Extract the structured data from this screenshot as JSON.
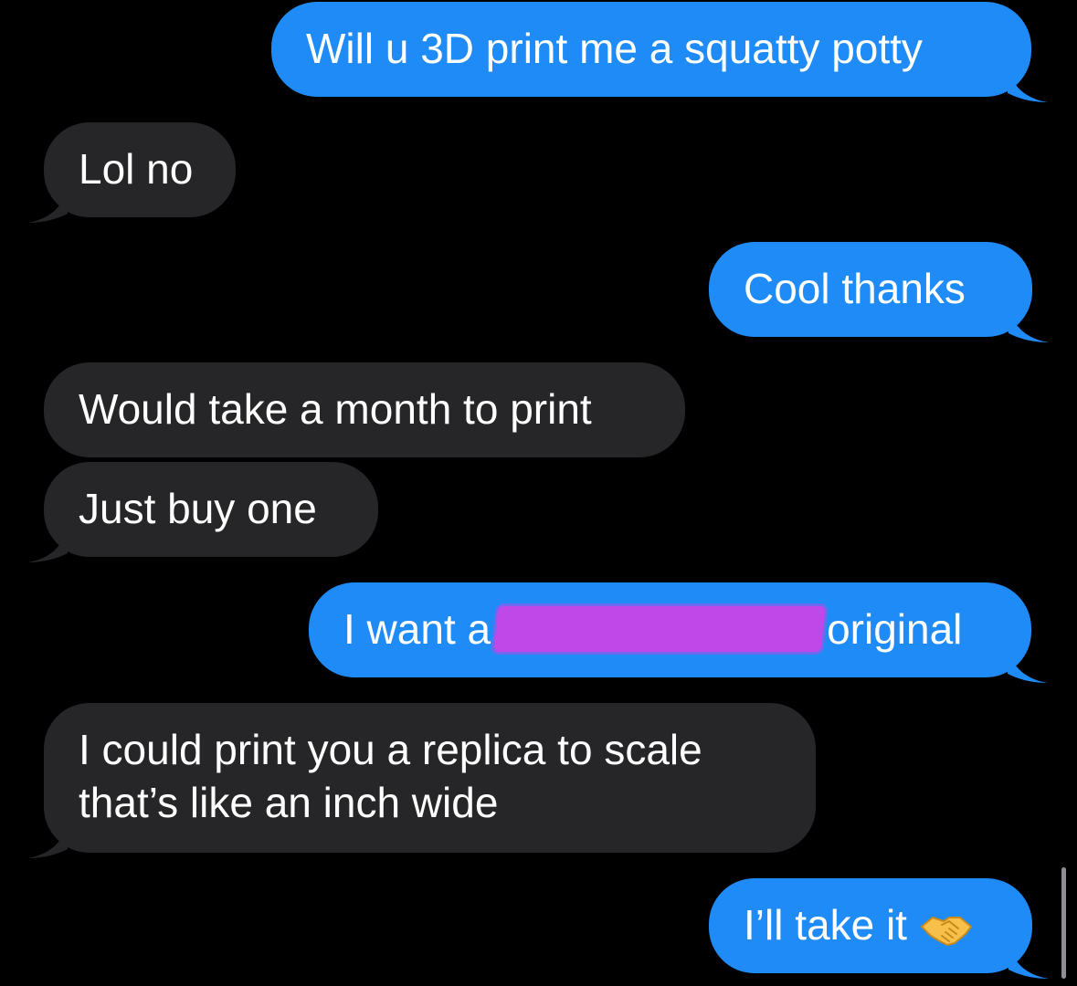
{
  "colors": {
    "background": "#000000",
    "sent_bubble": "#1f8bf7",
    "received_bubble": "#262628",
    "text": "#ffffff",
    "redaction": "#c048e8"
  },
  "messages": [
    {
      "side": "sent",
      "text": "Will u 3D print me a squatty potty"
    },
    {
      "side": "received",
      "text": "Lol no"
    },
    {
      "side": "sent",
      "text": "Cool thanks"
    },
    {
      "side": "received",
      "text": "Would take a month to print"
    },
    {
      "side": "received",
      "text": "Just buy one"
    },
    {
      "side": "sent",
      "text_before": "I want a",
      "text_after": "original",
      "redacted": true
    },
    {
      "side": "received",
      "line1": "I could print you a replica to scale",
      "line2": "that’s like an inch wide"
    },
    {
      "side": "sent",
      "text": "I’ll take it",
      "emoji": "handshake-emoji"
    }
  ]
}
